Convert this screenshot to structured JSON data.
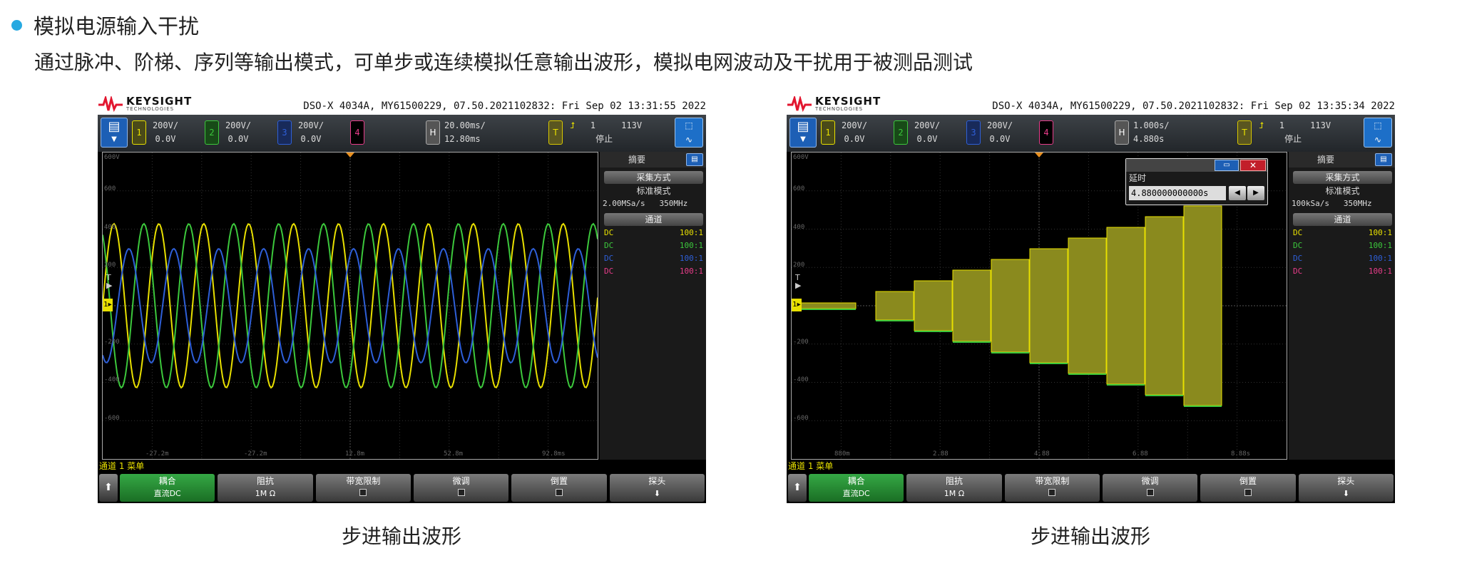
{
  "heading": "模拟电源输入干扰",
  "description": "通过脉冲、阶梯、序列等输出模式，可单步或连续模拟任意输出波形，模拟电网波动及干扰用于被测品测试",
  "colors": {
    "ch1": "#e8e000",
    "ch2": "#3cc83c",
    "ch3": "#2e5fd8",
    "ch4": "#e83c8a",
    "accent": "#27a9e1"
  },
  "scopes": [
    {
      "caption": "步进输出波形",
      "logo": {
        "name": "KEYSIGHT",
        "sub": "TECHNOLOGIES"
      },
      "ident": "DSO-X 4034A, MY61500229, 07.50.2021102832: Fri Sep 02 13:31:55 2022",
      "menu_icon": "menu-icon",
      "channels": [
        {
          "num": "1",
          "scale": "200V/",
          "offset": "0.0V"
        },
        {
          "num": "2",
          "scale": "200V/",
          "offset": "0.0V"
        },
        {
          "num": "3",
          "scale": "200V/",
          "offset": "0.0V"
        },
        {
          "num": "4",
          "scale": "",
          "offset": ""
        }
      ],
      "horizontal": {
        "label": "H",
        "scale": "20.00ms/",
        "position": "12.80ms"
      },
      "trigger": {
        "label": "T",
        "source": "1",
        "level": "113V",
        "status": "停止"
      },
      "levels": [
        "600V",
        "600",
        "400",
        "200",
        "0",
        "-200",
        "-400",
        "-600"
      ],
      "time_labels": [
        "-27.2m",
        "-27.2m",
        "12.8m",
        "52.8m",
        "92.8ms"
      ],
      "side": {
        "title": "摘要",
        "acq_button": "采集方式",
        "acq_mode": "标准模式",
        "sample_rate": "2.00MSa/s",
        "bandwidth": "350MHz",
        "channel_button": "通道",
        "ch_rows": [
          {
            "coupling": "DC",
            "probe": "100:1"
          },
          {
            "coupling": "DC",
            "probe": "100:1"
          },
          {
            "coupling": "DC",
            "probe": "100:1"
          },
          {
            "coupling": "DC",
            "probe": "100:1"
          }
        ]
      },
      "menu_title": "通道 1 菜单",
      "softkeys": [
        {
          "label": "耦合",
          "value": "直流DC"
        },
        {
          "label": "阻抗",
          "value": "1M Ω"
        },
        {
          "label": "带宽限制",
          "value": ""
        },
        {
          "label": "微调",
          "value": ""
        },
        {
          "label": "倒置",
          "value": ""
        },
        {
          "label": "探头",
          "value": ""
        }
      ]
    },
    {
      "caption": "步进输出波形",
      "logo": {
        "name": "KEYSIGHT",
        "sub": "TECHNOLOGIES"
      },
      "ident": "DSO-X 4034A, MY61500229, 07.50.2021102832: Fri Sep 02 13:35:34 2022",
      "menu_icon": "menu-icon",
      "channels": [
        {
          "num": "1",
          "scale": "200V/",
          "offset": "0.0V"
        },
        {
          "num": "2",
          "scale": "200V/",
          "offset": "0.0V"
        },
        {
          "num": "3",
          "scale": "200V/",
          "offset": "0.0V"
        },
        {
          "num": "4",
          "scale": "",
          "offset": ""
        }
      ],
      "horizontal": {
        "label": "H",
        "scale": "1.000s/",
        "position": "4.880s"
      },
      "trigger": {
        "label": "T",
        "source": "1",
        "level": "113V",
        "status": "停止"
      },
      "levels": [
        "600V",
        "600",
        "400",
        "200",
        "0",
        "-200",
        "-400",
        "-600"
      ],
      "time_labels": [
        "880m",
        "2.88",
        "4.88",
        "6.88",
        "8.88s"
      ],
      "dialog": {
        "label": "延时",
        "value": "4.880000000000s"
      },
      "side": {
        "title": "摘要",
        "acq_button": "采集方式",
        "acq_mode": "标准模式",
        "sample_rate": "100kSa/s",
        "bandwidth": "350MHz",
        "channel_button": "通道",
        "ch_rows": [
          {
            "coupling": "DC",
            "probe": "100:1"
          },
          {
            "coupling": "DC",
            "probe": "100:1"
          },
          {
            "coupling": "DC",
            "probe": "100:1"
          },
          {
            "coupling": "DC",
            "probe": "100:1"
          }
        ]
      },
      "menu_title": "通道 1 菜单",
      "softkeys": [
        {
          "label": "耦合",
          "value": "直流DC"
        },
        {
          "label": "阻抗",
          "value": "1M Ω"
        },
        {
          "label": "带宽限制",
          "value": ""
        },
        {
          "label": "微调",
          "value": ""
        },
        {
          "label": "倒置",
          "value": ""
        },
        {
          "label": "探头",
          "value": ""
        }
      ]
    }
  ]
}
